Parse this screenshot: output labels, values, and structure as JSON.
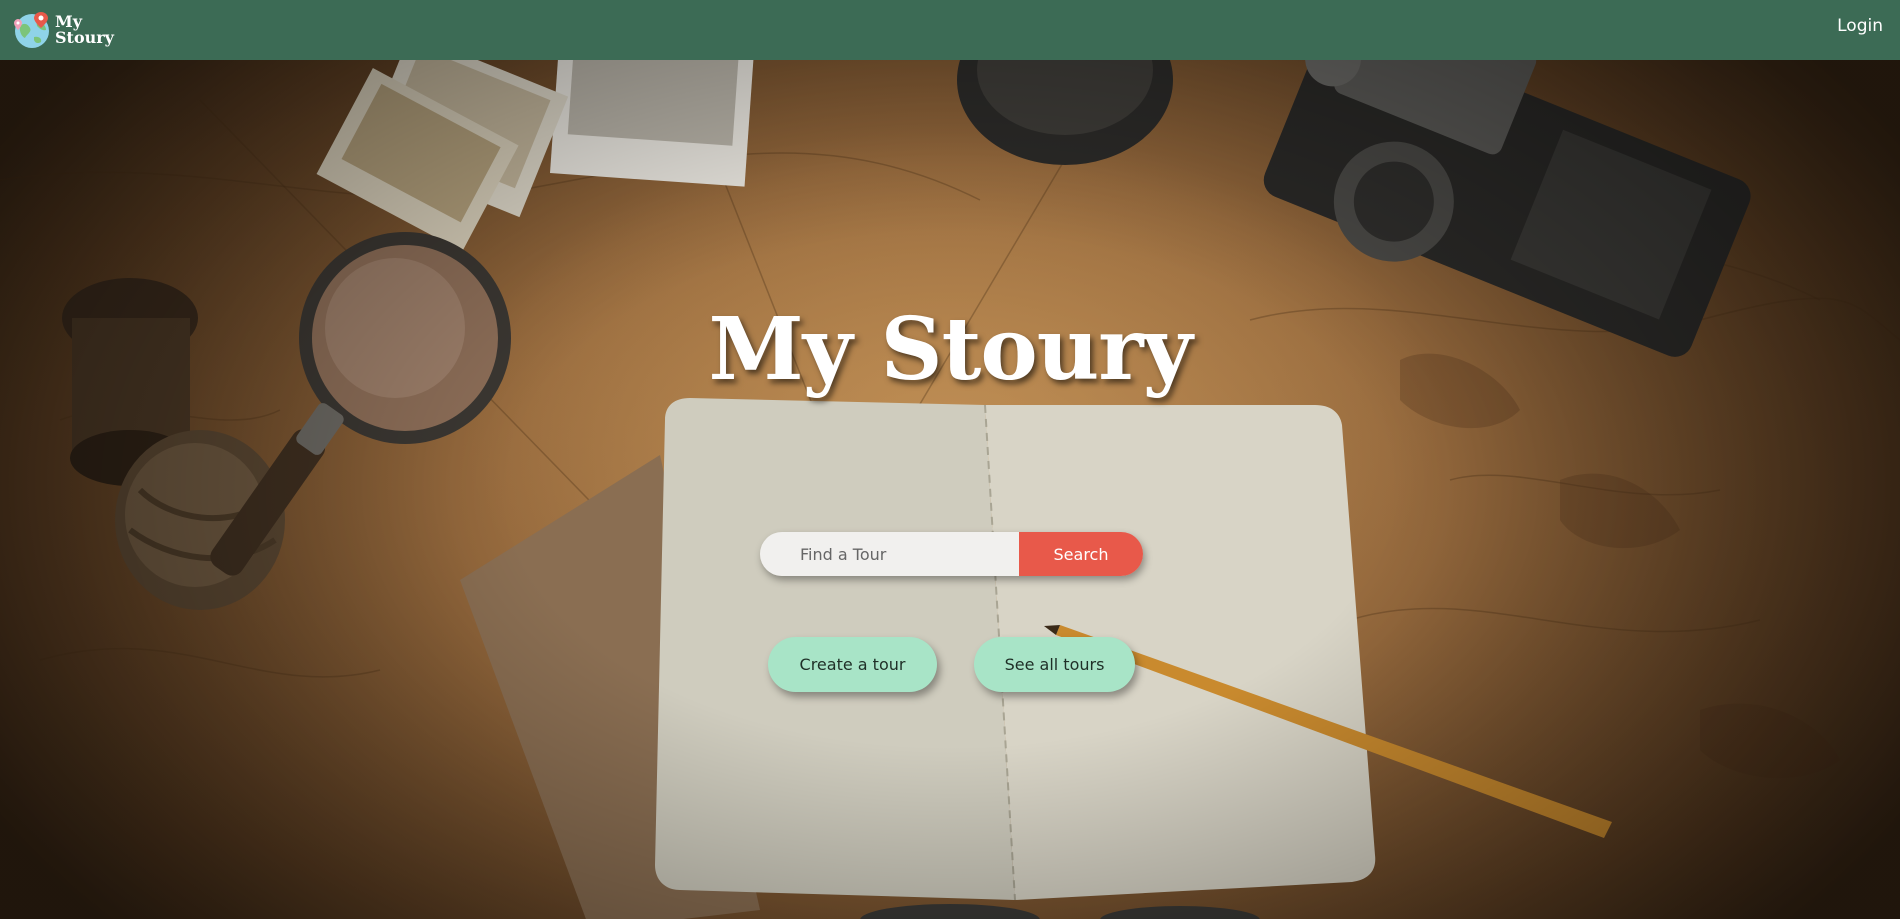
{
  "app": {
    "brand_line1": "My",
    "brand_line2": "Stoury",
    "login_label": "Login"
  },
  "hero": {
    "title": "My Stoury",
    "search": {
      "placeholder": "Find a Tour",
      "value": "",
      "button_label": "Search"
    },
    "actions": {
      "create_label": "Create a tour",
      "see_all_label": "See all tours"
    }
  },
  "colors": {
    "navbar": "#3c6b55",
    "search_button": "#e8594a",
    "pill_buttons": "#a8e4c7",
    "text_light": "#ffffff"
  },
  "icons": {
    "brand_logo": "globe-pin-icon"
  }
}
